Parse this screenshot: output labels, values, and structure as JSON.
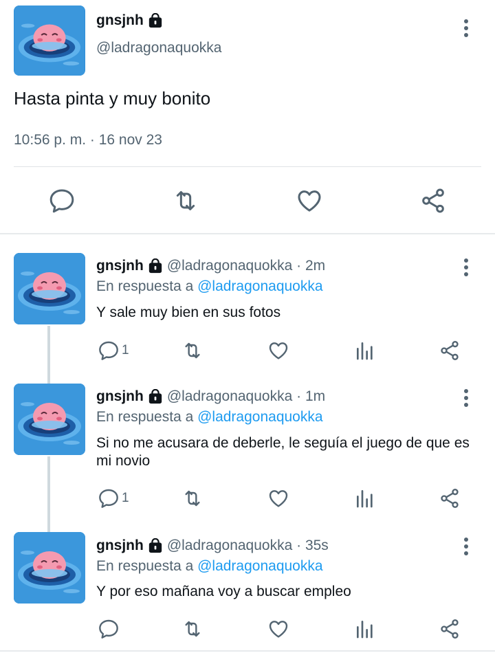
{
  "main_tweet": {
    "name": "gnsjnh",
    "handle": "@ladragonaquokka",
    "text": "Hasta pinta y muy bonito",
    "time": "10:56 p. m. · 16 nov 23"
  },
  "replies": [
    {
      "name": "gnsjnh",
      "handle_time": "@ladragonaquokka · 2m",
      "reply_prefix": "En respuesta a ",
      "reply_link": "@ladragonaquokka",
      "text": "Y sale muy bien en sus fotos",
      "reply_count": "1"
    },
    {
      "name": "gnsjnh",
      "handle_time": "@ladragonaquokka · 1m",
      "reply_prefix": "En respuesta a ",
      "reply_link": "@ladragonaquokka",
      "text": "Si no me acusara de deberle, le seguía el juego de que es mi novio",
      "reply_count": "1"
    },
    {
      "name": "gnsjnh",
      "handle_time": "@ladragonaquokka · 35s",
      "reply_prefix": "En respuesta a ",
      "reply_link": "@ladragonaquokka",
      "text": "Y por eso mañana voy a buscar empleo",
      "reply_count": ""
    }
  ],
  "colors": {
    "accent": "#1d9bf0",
    "secondary_text": "#536471",
    "avatar_bg": "#2f8fd8",
    "avatar_character": "#f49ab0"
  },
  "icons": [
    "lock-icon",
    "more-icon",
    "reply-icon",
    "retweet-icon",
    "like-icon",
    "share-icon",
    "analytics-icon"
  ]
}
